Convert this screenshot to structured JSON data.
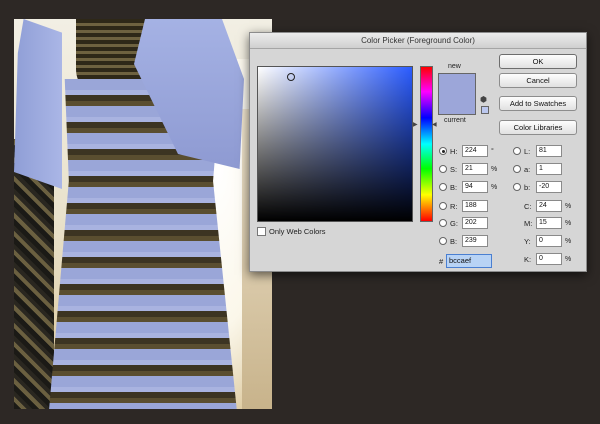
{
  "window_title": "Color Picker (Foreground Color)",
  "buttons": {
    "ok": "OK",
    "cancel": "Cancel",
    "add_to_swatches": "Add to Swatches",
    "color_libraries": "Color Libraries"
  },
  "labels": {
    "new": "new",
    "current": "current",
    "only_web_colors": "Only Web Colors",
    "hex_prefix": "#"
  },
  "colors": {
    "new_swatch": "#9ca6d9",
    "current_swatch": "#9ca6d9",
    "hue_base": "#2b5cff"
  },
  "hsb": {
    "h": {
      "label": "H:",
      "value": "224",
      "unit": "°",
      "selected": true
    },
    "s": {
      "label": "S:",
      "value": "21",
      "unit": "%"
    },
    "b": {
      "label": "B:",
      "value": "94",
      "unit": "%"
    }
  },
  "rgb": {
    "r": {
      "label": "R:",
      "value": "188"
    },
    "g": {
      "label": "G:",
      "value": "202"
    },
    "b": {
      "label": "B:",
      "value": "239"
    }
  },
  "lab": {
    "l": {
      "label": "L:",
      "value": "81"
    },
    "a": {
      "label": "a:",
      "value": "1"
    },
    "b": {
      "label": "b:",
      "value": "-20"
    }
  },
  "cmyk": {
    "c": {
      "label": "C:",
      "value": "24",
      "unit": "%"
    },
    "m": {
      "label": "M:",
      "value": "15",
      "unit": "%"
    },
    "y": {
      "label": "Y:",
      "value": "0",
      "unit": "%"
    },
    "k": {
      "label": "K:",
      "value": "0",
      "unit": "%"
    }
  },
  "hex": "bccaef",
  "icons": {
    "cube": "cube-icon",
    "hue_arrow": "slider-arrow-icon"
  }
}
